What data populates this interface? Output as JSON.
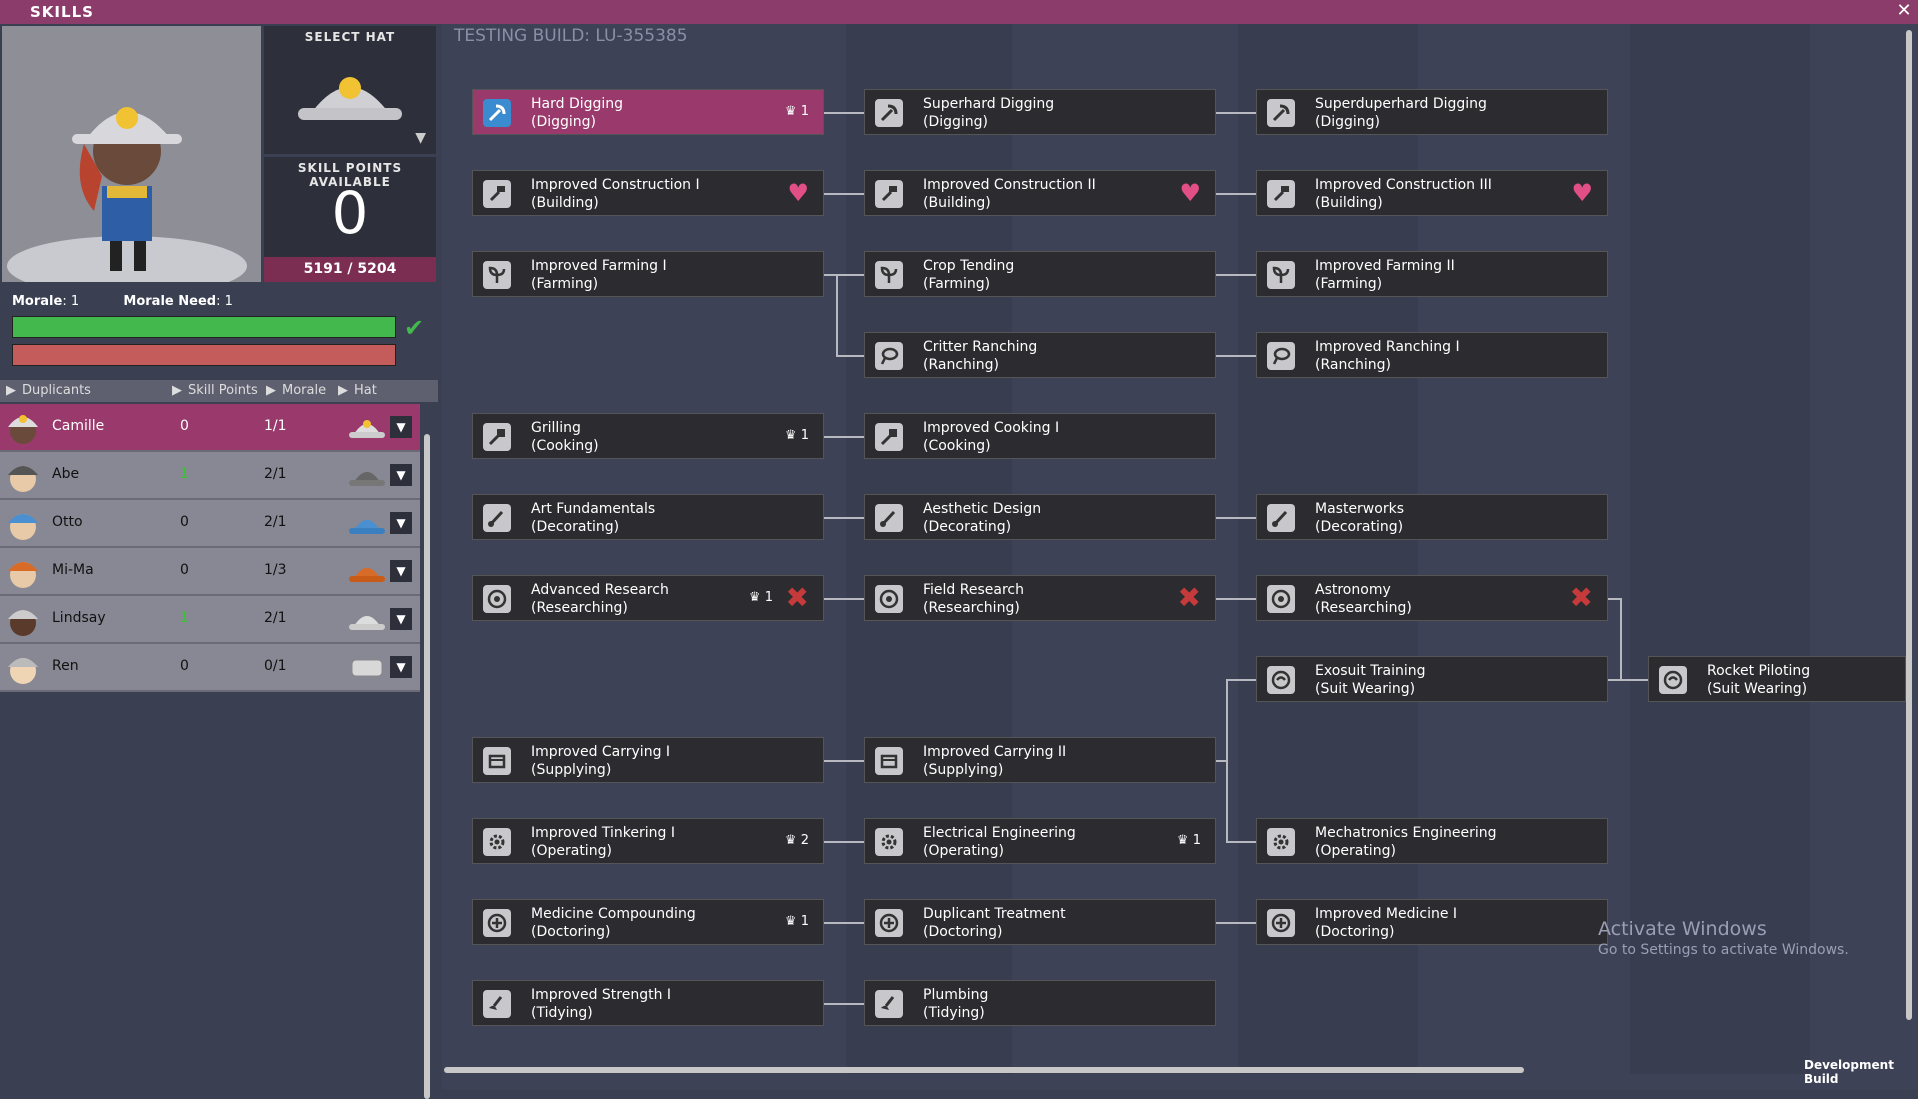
{
  "window": {
    "title": "SKILLS",
    "close_glyph": "✕"
  },
  "hat_panel": {
    "label": "SELECT HAT"
  },
  "skill_points": {
    "label": "SKILL POINTS AVAILABLE",
    "value": "0",
    "xp": "5191 / 5204"
  },
  "morale": {
    "morale_label": "Morale",
    "morale_value": ": 1",
    "need_label": "Morale Need",
    "need_value": ": 1"
  },
  "table_headers": {
    "duplicants": "Duplicants",
    "skill_points": "Skill Points",
    "morale": "Morale",
    "hat": "Hat"
  },
  "duplicants": [
    {
      "name": "Camille",
      "skill_points": "0",
      "morale": "1/1",
      "selected": true
    },
    {
      "name": "Abe",
      "skill_points": "1",
      "morale": "2/1"
    },
    {
      "name": "Otto",
      "skill_points": "0",
      "morale": "2/1"
    },
    {
      "name": "Mi-Ma",
      "skill_points": "0",
      "morale": "1/3"
    },
    {
      "name": "Lindsay",
      "skill_points": "1",
      "morale": "2/1"
    },
    {
      "name": "Ren",
      "skill_points": "0",
      "morale": "0/1"
    }
  ],
  "build": "TESTING BUILD: LU-355385",
  "skills": {
    "hard_digging": {
      "name": "Hard Digging",
      "group": "(Digging)",
      "count": "1"
    },
    "superhard_digging": {
      "name": "Superhard Digging",
      "group": "(Digging)"
    },
    "superduperhard_digging": {
      "name": "Superduperhard Digging",
      "group": "(Digging)"
    },
    "construction_1": {
      "name": "Improved Construction I",
      "group": "(Building)"
    },
    "construction_2": {
      "name": "Improved Construction II",
      "group": "(Building)"
    },
    "construction_3": {
      "name": "Improved Construction III",
      "group": "(Building)"
    },
    "farming_1": {
      "name": "Improved Farming I",
      "group": "(Farming)"
    },
    "crop_tending": {
      "name": "Crop Tending",
      "group": "(Farming)"
    },
    "farming_2": {
      "name": "Improved Farming II",
      "group": "(Farming)"
    },
    "critter_ranching": {
      "name": "Critter Ranching",
      "group": "(Ranching)"
    },
    "ranching_1": {
      "name": "Improved Ranching I",
      "group": "(Ranching)"
    },
    "grilling": {
      "name": "Grilling",
      "group": "(Cooking)",
      "count": "1"
    },
    "cooking_1": {
      "name": "Improved Cooking I",
      "group": "(Cooking)"
    },
    "art_fundamentals": {
      "name": "Art Fundamentals",
      "group": "(Decorating)"
    },
    "aesthetic_design": {
      "name": "Aesthetic Design",
      "group": "(Decorating)"
    },
    "masterworks": {
      "name": "Masterworks",
      "group": "(Decorating)"
    },
    "advanced_research": {
      "name": "Advanced Research",
      "group": "(Researching)",
      "count": "1"
    },
    "field_research": {
      "name": "Field Research",
      "group": "(Researching)"
    },
    "astronomy": {
      "name": "Astronomy",
      "group": "(Researching)"
    },
    "exosuit_training": {
      "name": "Exosuit Training",
      "group": "(Suit Wearing)"
    },
    "rocket_piloting": {
      "name": "Rocket Piloting",
      "group": "(Suit Wearing)"
    },
    "carrying_1": {
      "name": "Improved Carrying I",
      "group": "(Supplying)"
    },
    "carrying_2": {
      "name": "Improved Carrying II",
      "group": "(Supplying)"
    },
    "tinkering_1": {
      "name": "Improved Tinkering I",
      "group": "(Operating)",
      "count": "2"
    },
    "electrical_engineering": {
      "name": "Electrical Engineering",
      "group": "(Operating)",
      "count": "1"
    },
    "mechatronics": {
      "name": "Mechatronics Engineering",
      "group": "(Operating)"
    },
    "medicine_compounding": {
      "name": "Medicine Compounding",
      "group": "(Doctoring)",
      "count": "1"
    },
    "duplicant_treatment": {
      "name": "Duplicant Treatment",
      "group": "(Doctoring)"
    },
    "medicine_1": {
      "name": "Improved Medicine I",
      "group": "(Doctoring)"
    },
    "strength_1": {
      "name": "Improved Strength I",
      "group": "(Tidying)"
    },
    "plumbing": {
      "name": "Plumbing",
      "group": "(Tidying)"
    }
  },
  "watermark": {
    "line1": "Activate Windows",
    "line2": "Go to Settings to activate Windows."
  },
  "dev_build": "Development Build",
  "colors": {
    "accent": "#9a3a6c",
    "heart": "#e24f86",
    "x_mark": "#c53a3a",
    "morale_ok": "#43b84c"
  }
}
